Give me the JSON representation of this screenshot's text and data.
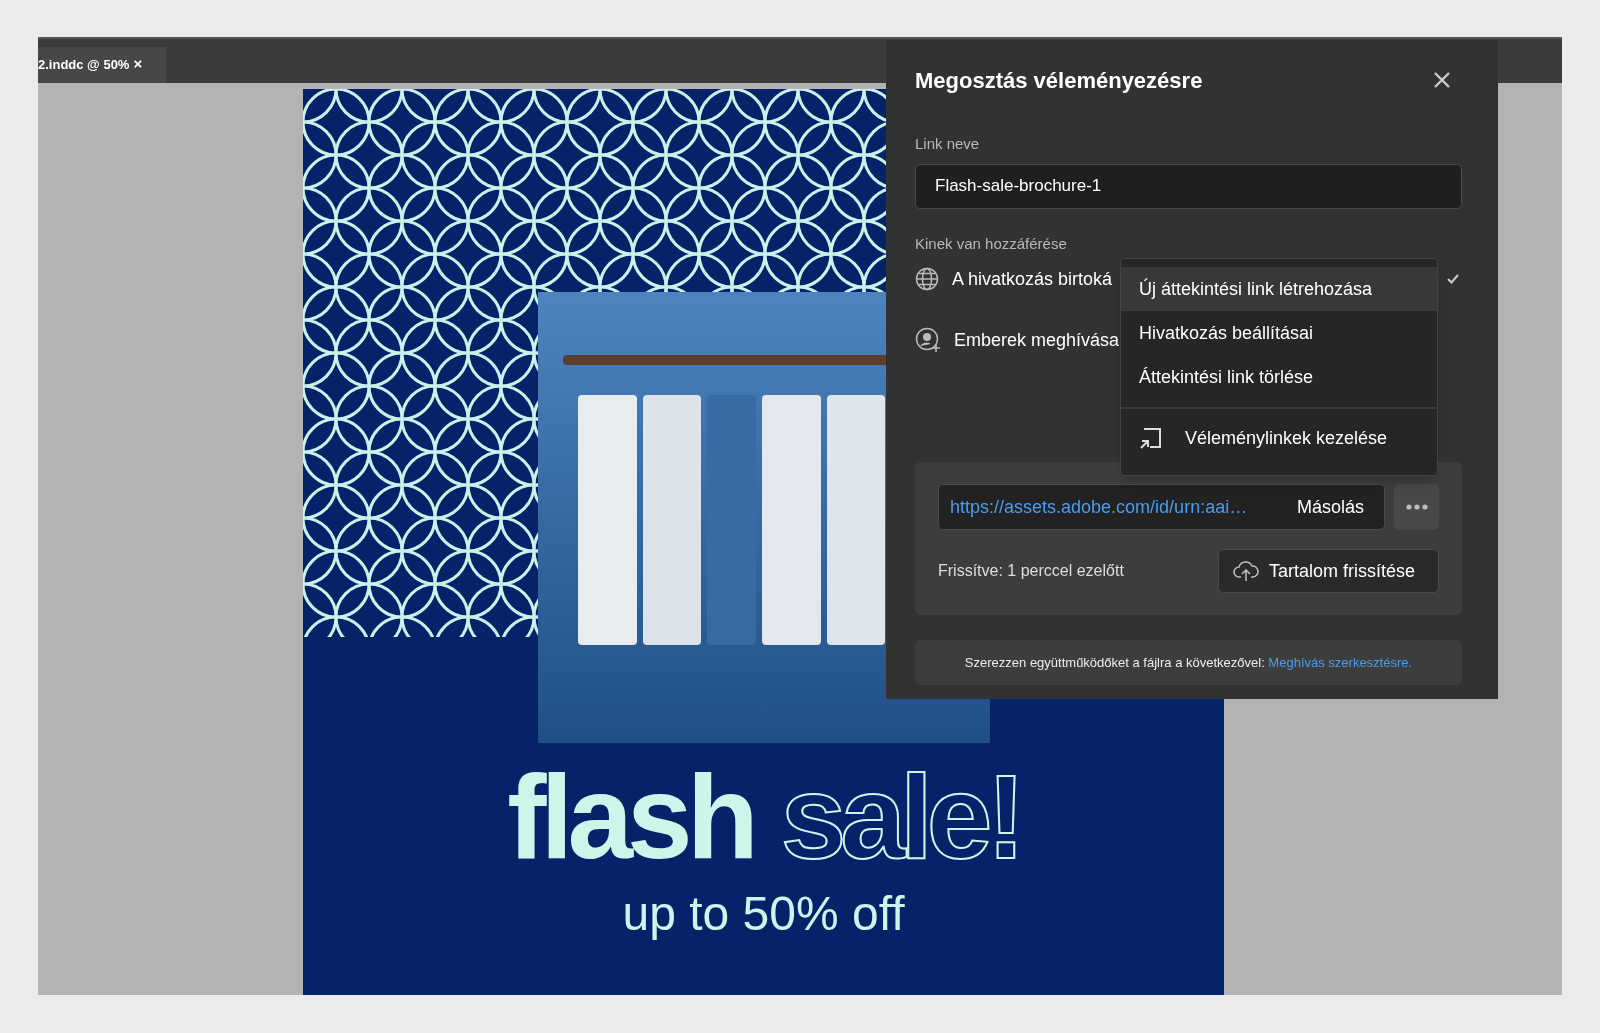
{
  "document_tab": {
    "label": "2.inddc @ 50%",
    "close": "×"
  },
  "poster": {
    "headline_filled": "flash",
    "headline_outline": "sale!",
    "subline": "up to 50% off"
  },
  "dialog": {
    "title": "Megosztás véleményezésre",
    "link_name": {
      "label": "Link neve",
      "value": "Flash-sale-brochure-1"
    },
    "access": {
      "label": "Kinek van hozzáférése",
      "options": [
        {
          "kind": "globe",
          "text": "A hivatkozás birtoká",
          "checked": true
        },
        {
          "kind": "invite",
          "text": "Emberek meghívása",
          "checked": false
        }
      ]
    },
    "menu": [
      {
        "kind": "text",
        "label": "Új áttekintési link létrehozása",
        "selected": true
      },
      {
        "kind": "text",
        "label": "Hivatkozás beállításai",
        "selected": false
      },
      {
        "kind": "text",
        "label": "Áttekintési link törlése",
        "selected": false
      },
      {
        "kind": "icon",
        "label": "Véleménylinkek kezelése",
        "selected": false
      }
    ],
    "link": {
      "url": "https://assets.adobe.com/id/urn:aai…",
      "copy": "Másolás",
      "updated": "Frissítve: 1 perccel ezelőtt",
      "refresh": "Tartalom frissítése"
    },
    "footer": {
      "text": "Szerezzen együttműködőket a fájlra a következővel:",
      "link": "Meghívás szerkesztésre."
    }
  }
}
